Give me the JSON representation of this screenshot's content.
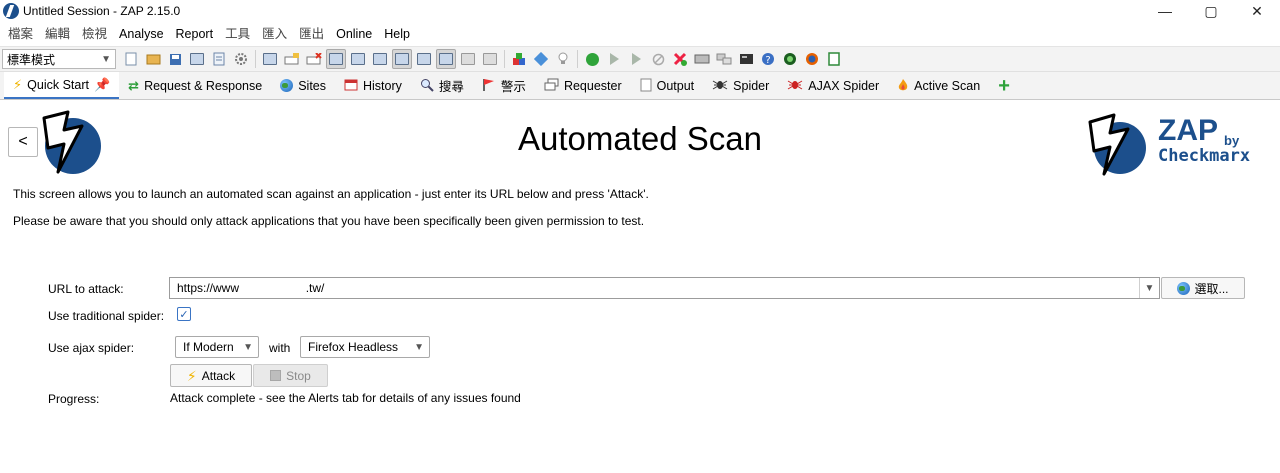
{
  "window": {
    "title": "Untitled Session - ZAP 2.15.0",
    "controls": {
      "minimize": "—",
      "maximize": "▢",
      "close": "✕"
    }
  },
  "menu": {
    "items": [
      "檔案",
      "編輯",
      "檢視",
      "Analyse",
      "Report",
      "工具",
      "匯入",
      "匯出",
      "Online",
      "Help"
    ]
  },
  "toolbar": {
    "mode_value": "標準模式"
  },
  "tabs": [
    {
      "label": "Quick Start",
      "icon": "lightning-icon"
    },
    {
      "label": "Request & Response",
      "icon": "arrows-icon"
    },
    {
      "label": "Sites",
      "icon": "globe-icon"
    },
    {
      "label": "History",
      "icon": "calendar-icon"
    },
    {
      "label": "搜尋",
      "icon": "search-icon"
    },
    {
      "label": "警示",
      "icon": "flag-icon"
    },
    {
      "label": "Requester",
      "icon": "requester-icon"
    },
    {
      "label": "Output",
      "icon": "document-icon"
    },
    {
      "label": "Spider",
      "icon": "spider-icon"
    },
    {
      "label": "AJAX Spider",
      "icon": "ajax-spider-icon"
    },
    {
      "label": "Active Scan",
      "icon": "flame-icon"
    }
  ],
  "page": {
    "back_label": "<",
    "title": "Automated Scan",
    "intro_1": "This screen allows you to launch an automated scan against  an application - just enter its URL below and press 'Attack'.",
    "intro_2": "Please be aware that you should only attack applications that you have been specifically been given permission to test.",
    "brand_zap": "ZAP",
    "brand_by": "by",
    "brand_vendor": "Checkmarx"
  },
  "form": {
    "url_label": "URL to attack:",
    "url_value": "https://www                    .tw/",
    "select_label": "選取...",
    "traditional_spider_label": "Use traditional spider:",
    "traditional_spider_checked": true,
    "ajax_spider_label": "Use ajax spider:",
    "ajax_mode_value": "If Modern",
    "with_label": "with",
    "browser_value": "Firefox Headless",
    "attack_label": "Attack",
    "stop_label": "Stop",
    "progress_label": "Progress:",
    "progress_value": "Attack complete - see the Alerts tab for details of any issues found"
  },
  "colors": {
    "brand_blue": "#1c4f8c",
    "active_tab_underline": "#3a74c4",
    "bolt_yellow": "#f0b400"
  }
}
